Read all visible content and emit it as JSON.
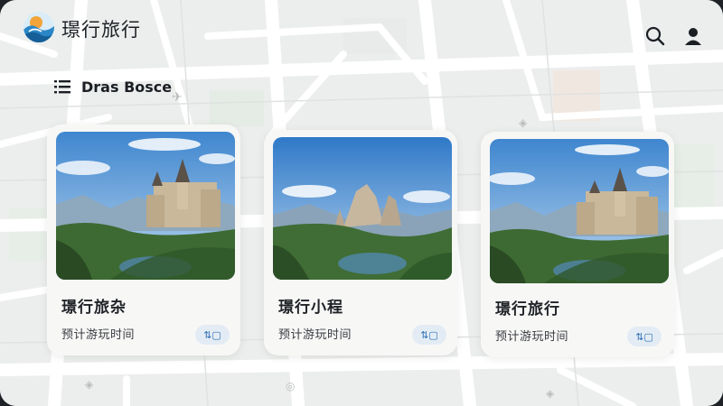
{
  "header": {
    "app_title": "璟行旅行",
    "logo_icon": "wave-sun-logo",
    "search_icon": "search-icon",
    "user_icon": "user-icon"
  },
  "subheader": {
    "menu_icon": "list-menu-icon",
    "label": "Dras Bosce"
  },
  "cards": [
    {
      "title": "璟行旅杂",
      "subtitle": "预计游玩时间",
      "badge": "⇅▢",
      "image": "castle-on-hill"
    },
    {
      "title": "璟行小程",
      "subtitle": "预计游玩时间",
      "badge": "⇅▢",
      "image": "rock-spires-valley"
    },
    {
      "title": "璟行旅行",
      "subtitle": "预计游玩时间",
      "badge": "⇅▢",
      "image": "castle-on-hill"
    }
  ],
  "colors": {
    "map_background": "#eef0ef",
    "road": "#ffffff",
    "badge_bg": "#e3ecf4",
    "badge_text": "#2f6fb3"
  }
}
